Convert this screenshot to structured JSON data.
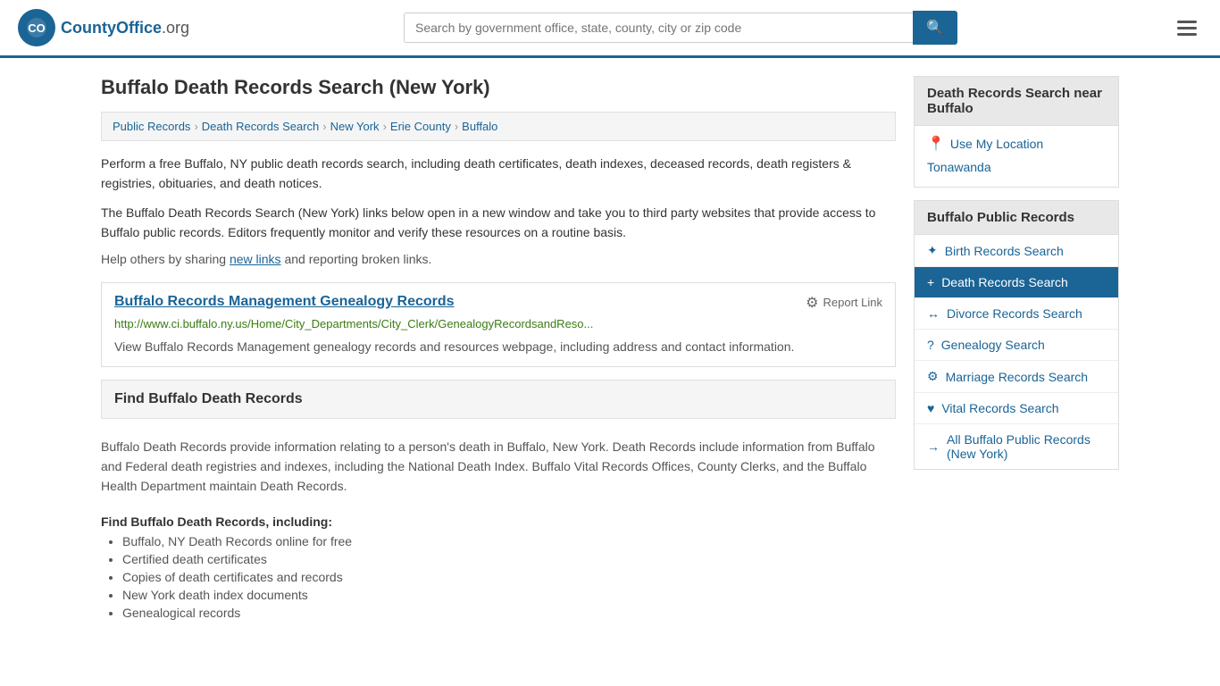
{
  "header": {
    "logo_text": "CountyOffice",
    "logo_tld": ".org",
    "search_placeholder": "Search by government office, state, county, city or zip code"
  },
  "page": {
    "title": "Buffalo Death Records Search (New York)",
    "breadcrumb": [
      {
        "label": "Public Records",
        "href": "#"
      },
      {
        "label": "Death Records Search",
        "href": "#"
      },
      {
        "label": "New York",
        "href": "#"
      },
      {
        "label": "Erie County",
        "href": "#"
      },
      {
        "label": "Buffalo",
        "href": "#"
      }
    ],
    "description1": "Perform a free Buffalo, NY public death records search, including death certificates, death indexes, deceased records, death registers & registries, obituaries, and death notices.",
    "description2": "The Buffalo Death Records Search (New York) links below open in a new window and take you to third party websites that provide access to Buffalo public records. Editors frequently monitor and verify these resources on a routine basis.",
    "help_text": "Help others by sharing ",
    "help_link": "new links",
    "help_text2": " and reporting broken links."
  },
  "record_card": {
    "title": "Buffalo Records Management Genealogy Records",
    "url": "http://www.ci.buffalo.ny.us/Home/City_Departments/City_Clerk/GenealogyRecordsandReso...",
    "description": "View Buffalo Records Management genealogy records and resources webpage, including address and contact information.",
    "report_label": "Report Link"
  },
  "find_section": {
    "heading": "Find Buffalo Death Records",
    "body": "Buffalo Death Records provide information relating to a person's death in Buffalo, New York. Death Records include information from Buffalo and Federal death registries and indexes, including the National Death Index. Buffalo Vital Records Offices, County Clerks, and the Buffalo Health Department maintain Death Records.",
    "list_label": "Find Buffalo Death Records, including:",
    "list_items": [
      "Buffalo, NY Death Records online for free",
      "Certified death certificates",
      "Copies of death certificates and records",
      "New York death index documents",
      "Genealogical records"
    ]
  },
  "sidebar": {
    "nearby_header": "Death Records Search near Buffalo",
    "use_my_location": "Use My Location",
    "nearby_links": [
      "Tonawanda"
    ],
    "public_records_header": "Buffalo Public Records",
    "records_links": [
      {
        "label": "Birth Records Search",
        "icon": "✦",
        "active": false
      },
      {
        "label": "Death Records Search",
        "icon": "+",
        "active": true
      },
      {
        "label": "Divorce Records Search",
        "icon": "↔",
        "active": false
      },
      {
        "label": "Genealogy Search",
        "icon": "?",
        "active": false
      },
      {
        "label": "Marriage Records Search",
        "icon": "⚙",
        "active": false
      },
      {
        "label": "Vital Records Search",
        "icon": "♥",
        "active": false
      },
      {
        "label": "All Buffalo Public Records (New York)",
        "icon": "→",
        "active": false
      }
    ]
  }
}
